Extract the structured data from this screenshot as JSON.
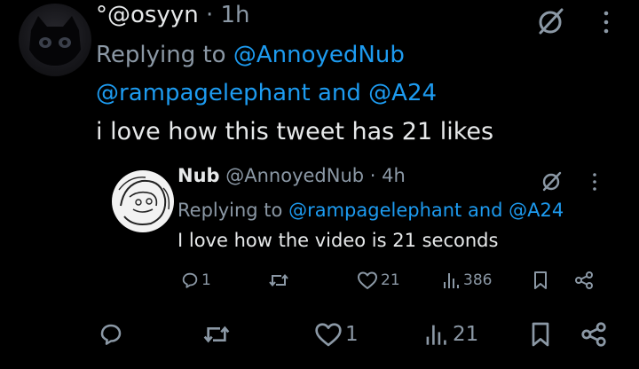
{
  "tweet": {
    "handle": "°@osyyn",
    "separator": "·",
    "time": "1h",
    "replying_prefix": "Replying to ",
    "replying_user1": "@AnnoyedNub",
    "replying_user2": "@rampagelephant",
    "replying_and": " and ",
    "replying_user3": "@A24",
    "text": "i love how this tweet has 21 likes",
    "reply_count": "",
    "retweet_count": "",
    "like_count": "1",
    "view_count": "21"
  },
  "quoted": {
    "name": "Nub",
    "handle": "@AnnoyedNub",
    "separator": "·",
    "time": "4h",
    "replying_prefix": "Replying to ",
    "replying_user1": "@rampagelephant",
    "replying_and": " and ",
    "replying_user2": "@A24",
    "text": "I love how the video is 21 seconds",
    "reply_count": "1",
    "retweet_count": "",
    "like_count": "21",
    "view_count": "386"
  },
  "colors": {
    "background": "#000000",
    "text": "#e7e9ea",
    "secondary": "#8b98a5",
    "link": "#1d9bf0"
  }
}
